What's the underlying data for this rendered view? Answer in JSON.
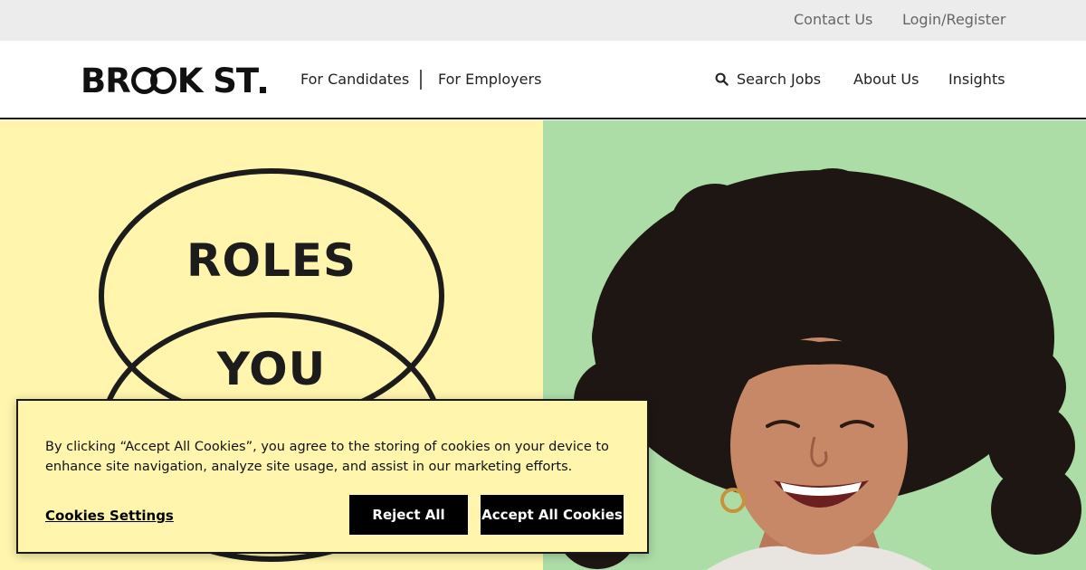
{
  "utility_nav": {
    "contact": "Contact Us",
    "login": "Login/Register"
  },
  "header": {
    "logo_letters_left": "BR",
    "logo_letters_right": "K ST"
  },
  "main_nav": {
    "candidates": "For Candidates",
    "employers": "For Employers",
    "search_jobs": "Search Jobs",
    "about": "About Us",
    "insights": "Insights"
  },
  "hero": {
    "word_1": "ROLES",
    "word_2": "YOU",
    "left_bg": "#fff5ad",
    "right_bg": "#addda7"
  },
  "cookie_banner": {
    "text": "By clicking “Accept All Cookies”, you agree to the storing of cookies on your device to enhance site navigation, analyze site usage, and assist in our marketing efforts.",
    "settings_label": "Cookies Settings",
    "reject_label": "Reject All",
    "accept_label": "Accept All Cookies"
  },
  "icons": {
    "search": "search-icon",
    "logo": "brook-street-logo"
  }
}
